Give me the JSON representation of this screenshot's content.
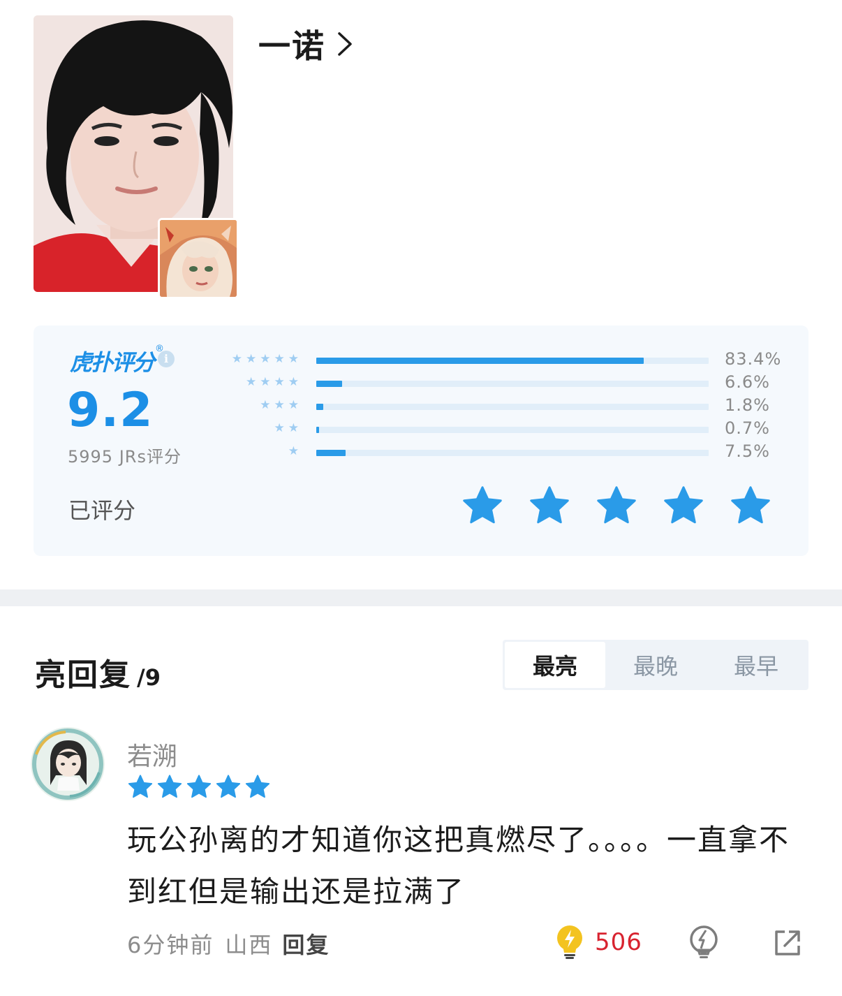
{
  "player": {
    "name": "一诺",
    "photo": "player-photo",
    "hero_badge": "hero-avatar"
  },
  "rating": {
    "brand": "虎扑评分",
    "brand_mark": "®",
    "info_icon": "info-icon",
    "score": "9.2",
    "count": "5995 JRs评分",
    "rated_label": "已评分",
    "my_stars": 5,
    "distribution": [
      {
        "stars": 5,
        "value": 83.4,
        "label": "83.4%"
      },
      {
        "stars": 4,
        "value": 6.6,
        "label": "6.6%"
      },
      {
        "stars": 3,
        "value": 1.8,
        "label": "1.8%"
      },
      {
        "stars": 2,
        "value": 0.7,
        "label": "0.7%"
      },
      {
        "stars": 1,
        "value": 7.5,
        "label": "7.5%"
      }
    ],
    "colors": {
      "accent": "#2a9be8",
      "track": "#e1eef9",
      "card_bg": "#f5f9fd"
    }
  },
  "replies": {
    "title": "亮回复",
    "count": "/9",
    "tabs": [
      {
        "label": "最亮",
        "active": true
      },
      {
        "label": "最晚",
        "active": false
      },
      {
        "label": "最早",
        "active": false
      }
    ],
    "items": [
      {
        "user": "若溯",
        "stars": 5,
        "text": "玩公孙离的才知道你这把真燃尽了。。。。一直拿不到红但是输出还是拉满了",
        "time": "6分钟前",
        "location": "山西",
        "reply_label": "回复",
        "likes": "506",
        "like_icon": "lightbulb-icon",
        "dislike_icon": "dislike-bulb-icon",
        "share_icon": "share-icon"
      }
    ]
  }
}
